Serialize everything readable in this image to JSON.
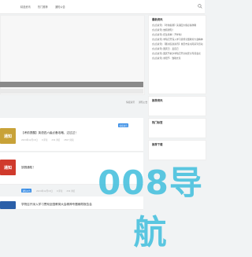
{
  "nav": {
    "items": [
      "精选资讯",
      "热门推荐",
      "通知公告"
    ]
  },
  "colors": {
    "accent": "#3ebddc",
    "category": "#3a8ee6"
  },
  "tags_row": [
    "情报资讯",
    "通知公告"
  ],
  "sidebar": {
    "latest_title": "最新资讯",
    "latest_items": [
      "[信息资讯] 【考前提醒】英语四六级必备攻略",
      "[信息资讯] 放假通知！",
      "[信息资讯] 招生简章！开学啦！",
      "[信息资讯] 学院召开深入学习贯彻全国教育大会精神",
      "[信息资讯] 【图书馆新资讯】重庆市读书月系列活动",
      "[信息资讯] 国庆日 · 爱自己",
      "[信息资讯] 国庆节前夕学院召开全校安全专项会议",
      "[信息资讯] 重阳节 · 致敬长辈"
    ],
    "recommend_title": "推荐资讯",
    "hot_title": "热门标签",
    "random_title": "推荐下载"
  },
  "posts": [
    {
      "thumb_text": "通知",
      "title": "【考前提醒】英语四六级必备攻略，过过过！",
      "category": "情报资讯",
      "date": "2024年12月13日",
      "meta_extra": [
        "0 评论",
        "234 浏览",
        "2567 阅读"
      ]
    },
    {
      "thumb_text": "通知",
      "title": "放假通知！",
      "category": "通知公告",
      "date": "2024年12月13日",
      "meta_extra": [
        "0 评论",
        "234 浏览"
      ]
    },
    {
      "thumb_text": "",
      "title": "学院召开深入学习贯彻全国教育大会精神专题辅导报告会",
      "category": "",
      "date": "",
      "meta_extra": []
    }
  ],
  "watermark": {
    "text": "008导航"
  }
}
